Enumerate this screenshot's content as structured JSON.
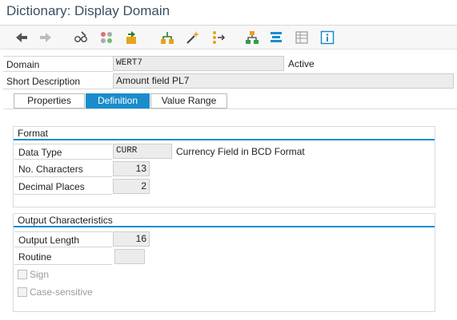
{
  "window": {
    "title": "Dictionary: Display Domain"
  },
  "toolbar": {
    "buttons": [
      {
        "icon": "back-arrow-icon"
      },
      {
        "icon": "forward-arrow-icon"
      },
      {
        "icon": "glasses-pencil-icon"
      },
      {
        "icon": "other-object-icon"
      },
      {
        "icon": "activate-icon"
      },
      {
        "icon": "where-used-icon"
      },
      {
        "icon": "magic-wand-icon"
      },
      {
        "icon": "navigate-tree-icon"
      },
      {
        "icon": "hierarchy-icon"
      },
      {
        "icon": "stack-icon"
      },
      {
        "icon": "table-icon"
      },
      {
        "icon": "info-icon"
      }
    ]
  },
  "header": {
    "domain_label": "Domain",
    "domain_value": "WERT7",
    "status": "Active",
    "short_desc_label": "Short Description",
    "short_desc_value": "Amount field PL7"
  },
  "tabs": [
    {
      "label": "Properties",
      "active": false
    },
    {
      "label": "Definition",
      "active": true
    },
    {
      "label": "Value Range",
      "active": false
    }
  ],
  "format": {
    "title": "Format",
    "data_type_label": "Data Type",
    "data_type_value": "CURR",
    "data_type_desc": "Currency Field in BCD Format",
    "no_chars_label": "No. Characters",
    "no_chars_value": "13",
    "decimal_label": "Decimal Places",
    "decimal_value": "2"
  },
  "output": {
    "title": "Output Characteristics",
    "length_label": "Output Length",
    "length_value": "16",
    "routine_label": "Routine",
    "routine_value": "",
    "sign_label": "Sign",
    "case_label": "Case-sensitive"
  },
  "colors": {
    "accent": "#1a8ccc",
    "title": "#3a4f63",
    "field_bg": "#ececec"
  }
}
